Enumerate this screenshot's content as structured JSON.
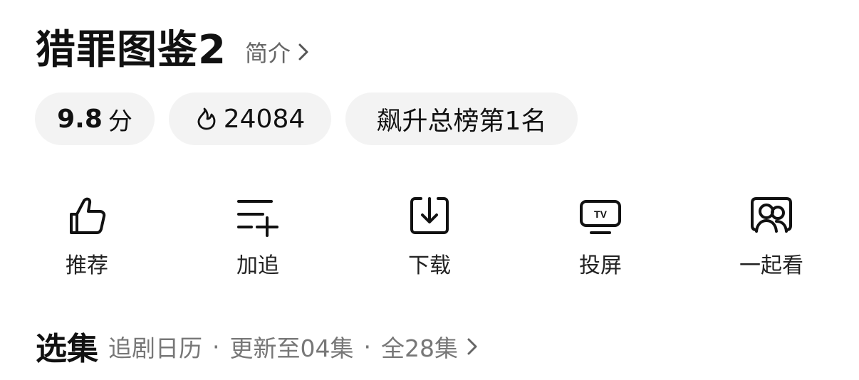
{
  "title": "猎罪图鉴2",
  "intro_label": "简介",
  "stats": {
    "score_value": "9.8",
    "score_unit": "分",
    "heat_value": "24084",
    "rank_text": "飙升总榜第1名"
  },
  "actions": [
    {
      "label": "推荐",
      "icon": "thumbs-up-icon"
    },
    {
      "label": "加追",
      "icon": "add-to-list-icon"
    },
    {
      "label": "下载",
      "icon": "download-icon"
    },
    {
      "label": "投屏",
      "icon": "tv-cast-icon"
    },
    {
      "label": "一起看",
      "icon": "watch-together-icon"
    }
  ],
  "episodes": {
    "title": "选集",
    "calendar": "追剧日历",
    "update": "更新至04集",
    "total": "全28集",
    "separator": "·"
  },
  "colors": {
    "text_primary": "#111111",
    "text_secondary": "#777777",
    "chip_background": "#f3f3f3"
  }
}
